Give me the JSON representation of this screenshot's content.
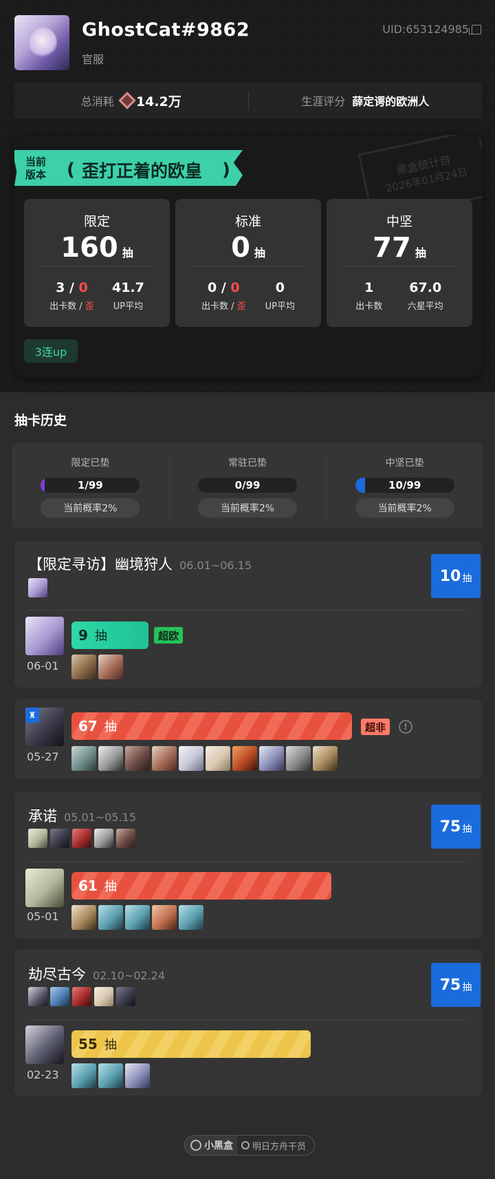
{
  "profile": {
    "username": "GhostCat#9862",
    "server": "官服",
    "uid": "UID:653124985"
  },
  "summary": {
    "spend_label": "总消耗",
    "spend_value": "14.2万",
    "rating_label": "生涯评分",
    "rating_value": "薛定谔的欧洲人"
  },
  "version": {
    "ribbon_small": "当前版本",
    "title": "歪打正着的欧皇",
    "stamp_line1": "黑盒统计自",
    "stamp_line2": "2026年01月24日",
    "pools": [
      {
        "name": "限定",
        "count": "160",
        "unit": "抽",
        "s1_num": "3",
        "s1_num2": "0",
        "s1_label": "出卡数",
        "s1_label2": "歪",
        "s2_num": "41.7",
        "s2_label": "UP平均"
      },
      {
        "name": "标准",
        "count": "0",
        "unit": "抽",
        "s1_num": "0",
        "s1_num2": "0",
        "s1_label": "出卡数",
        "s1_label2": "歪",
        "s2_num": "0",
        "s2_label": "UP平均"
      },
      {
        "name": "中坚",
        "count": "77",
        "unit": "抽",
        "s1_num": "1",
        "s1_label": "出卡数",
        "s2_num": "67.0",
        "s2_label": "六星平均"
      }
    ],
    "tag": "3连up"
  },
  "history": {
    "title": "抽卡历史",
    "pity": [
      {
        "label": "限定已垫",
        "value": "1/99",
        "progress": 0.01,
        "rate": "当前概率2%"
      },
      {
        "label": "常驻已垫",
        "value": "0/99",
        "progress": 0,
        "rate": "当前概率2%"
      },
      {
        "label": "中坚已垫",
        "value": "10/99",
        "progress": 0.1,
        "rate": "当前概率2%"
      }
    ],
    "banners": [
      {
        "title": "【限定寻访】幽境狩人",
        "date": "06.01~06.15",
        "total": "10",
        "unit": "抽",
        "pull": "9",
        "pull_unit": "抽",
        "pull_date": "06-01",
        "tag": "超欧"
      },
      {
        "pull": "67",
        "pull_unit": "抽",
        "pull_date": "05-27",
        "tag": "超非",
        "info": "!",
        "flag": "♜"
      },
      {
        "title": "承诺",
        "date": "05.01~05.15",
        "total": "75",
        "unit": "抽",
        "pull": "61",
        "pull_unit": "抽",
        "pull_date": "05-01"
      },
      {
        "title": "劫尽古今",
        "date": "02.10~02.24",
        "total": "75",
        "unit": "抽",
        "pull": "55",
        "pull_unit": "抽",
        "pull_date": "02-23"
      }
    ]
  },
  "footer": {
    "brand": "小黑盒",
    "search": "明日方舟干员"
  }
}
